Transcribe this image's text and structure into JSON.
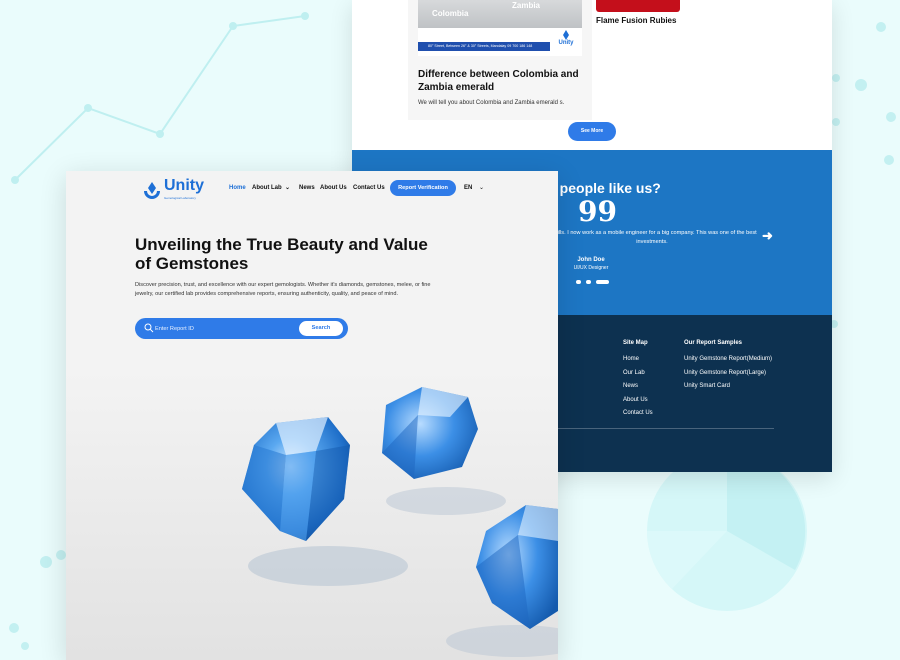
{
  "front": {
    "logo": {
      "name": "Unity",
      "tagline": "Gemological Laboratory"
    },
    "nav": {
      "home": "Home",
      "about_lab": "About Lab",
      "news": "News",
      "about_us": "About Us",
      "contact_us": "Contact Us",
      "report_verification": "Report Verification",
      "language": "EN"
    },
    "hero": {
      "title": "Unveiling the True Beauty and Value of Gemstones",
      "description": "Discover precision, trust, and excellence with our expert gemologists. Whether it's diamonds, gemstones, melee, or fine jewelry, our certified lab provides comprehensive reports, ensuring authenticity, quality, and peace of mind."
    },
    "search": {
      "placeholder": "Enter Report ID",
      "button": "Search"
    }
  },
  "back": {
    "article": {
      "image_left_label": "Colombia",
      "image_right_label": "Zambia",
      "image_strip": "80° Street, Between 26° & 30° Streets, Mandalay   09 700 186 148",
      "image_logo": "Unity",
      "title": "Difference between Colombia and Zambia emerald",
      "excerpt": "We will tell you about Colombia and Zambia emerald s."
    },
    "article2": {
      "title": "Flame Fusion Rubies"
    },
    "see_more": "See More",
    "testimonial": {
      "heading": "y people like us?",
      "quote_mark": "99",
      "text": "g skills. I now work as a mobile engineer for a big company. This was one of the best investments.",
      "name": "John Doe",
      "role": "UI/UX Designer"
    },
    "footer": {
      "sitemap": {
        "heading": "Site Map",
        "items": [
          "Home",
          "Our Lab",
          "News",
          "About Us",
          "Contact Us"
        ]
      },
      "samples": {
        "heading": "Our Report Samples",
        "items": [
          "Unity Gemstone Report(Medium)",
          "Unity Gemstone Report(Large)",
          "Unity Smart Card"
        ]
      }
    }
  },
  "colors": {
    "background": "#eafcfc",
    "accent": "#2f7be8",
    "testimonial_bg": "#1d76c4",
    "footer_bg": "#0d3150",
    "ruby": "#c40f1b"
  }
}
